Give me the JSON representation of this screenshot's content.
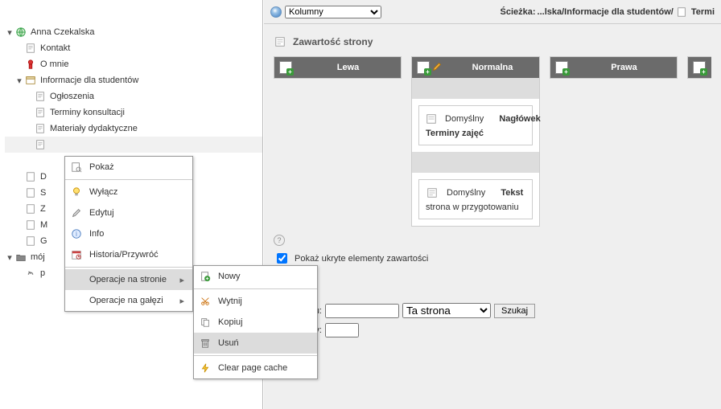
{
  "topbar": {
    "select_label": "Kolumny",
    "path_label": "Ścieżka: ",
    "path_trunc": "...lska/Informacje dla studentów/",
    "path_current": "Termi"
  },
  "section_title": "Zawartość strony",
  "columns": {
    "left": "Lewa",
    "normal": "Normalna",
    "right": "Prawa"
  },
  "block1": {
    "scope": "Domyślny",
    "type": "Nagłówek",
    "text": "Terminy zajęć"
  },
  "block2": {
    "scope": "Domyślny",
    "type": "Tekst",
    "text": "strona w przygotowaniu"
  },
  "checkbox_label": "Pokaż ukryte elementy zawartości",
  "search": {
    "field1_suffix": "u:",
    "select_option": "Ta strona",
    "button": "Szukaj",
    "field2_suffix": "rdy:"
  },
  "tree": {
    "root": "Anna Czekalska",
    "kontakt": "Kontakt",
    "omnie": "O mnie",
    "info": "Informacje dla studentów",
    "ogloszenia": "Ogłoszenia",
    "terminy": "Terminy konsultacji",
    "materialy": "Materiały dydaktyczne",
    "d": "D",
    "s": "S",
    "z": "Z",
    "m": "M",
    "g": "G",
    "moj": "mój",
    "p": "p"
  },
  "ctx1": {
    "pokaz": "Pokaż",
    "wylacz": "Wyłącz",
    "edytuj": "Edytuj",
    "info": "Info",
    "historia": "Historia/Przywróć",
    "op_stronie": "Operacje na stronie",
    "op_galezi": "Operacje na gałęzi"
  },
  "ctx2": {
    "nowy": "Nowy",
    "wytnij": "Wytnij",
    "kopiuj": "Kopiuj",
    "usun": "Usuń",
    "cache": "Clear page cache"
  }
}
